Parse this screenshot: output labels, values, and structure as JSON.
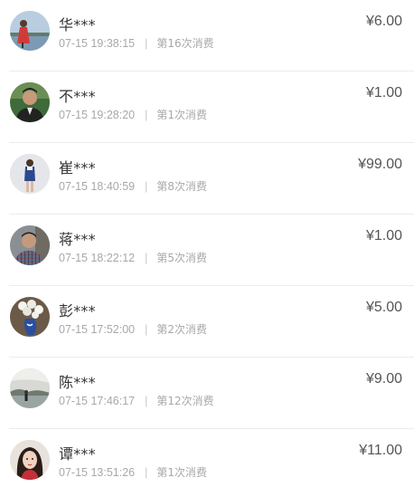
{
  "records": [
    {
      "name": "华***",
      "time": "07-15 19:38:15",
      "count": "第16次消费",
      "amount": "¥6.00",
      "avatar": "avatar-woman-red-dress-lake"
    },
    {
      "name": "不***",
      "time": "07-15 19:28:20",
      "count": "第1次消费",
      "amount": "¥1.00",
      "avatar": "avatar-man-green-background"
    },
    {
      "name": "崔***",
      "time": "07-15 18:40:59",
      "count": "第8次消费",
      "amount": "¥99.00",
      "avatar": "avatar-woman-uniform-standing"
    },
    {
      "name": "蒋***",
      "time": "07-15 18:22:12",
      "count": "第5次消费",
      "amount": "¥1.00",
      "avatar": "avatar-man-plaid-shirt"
    },
    {
      "name": "彭***",
      "time": "07-15 17:52:00",
      "count": "第2次消费",
      "amount": "¥5.00",
      "avatar": "avatar-flowers-vase"
    },
    {
      "name": "陈***",
      "time": "07-15 17:46:17",
      "count": "第12次消费",
      "amount": "¥9.00",
      "avatar": "avatar-person-waterside"
    },
    {
      "name": "谭***",
      "time": "07-15 13:51:26",
      "count": "第1次消费",
      "amount": "¥11.00",
      "avatar": "avatar-woman-portrait"
    }
  ],
  "separator": "|"
}
